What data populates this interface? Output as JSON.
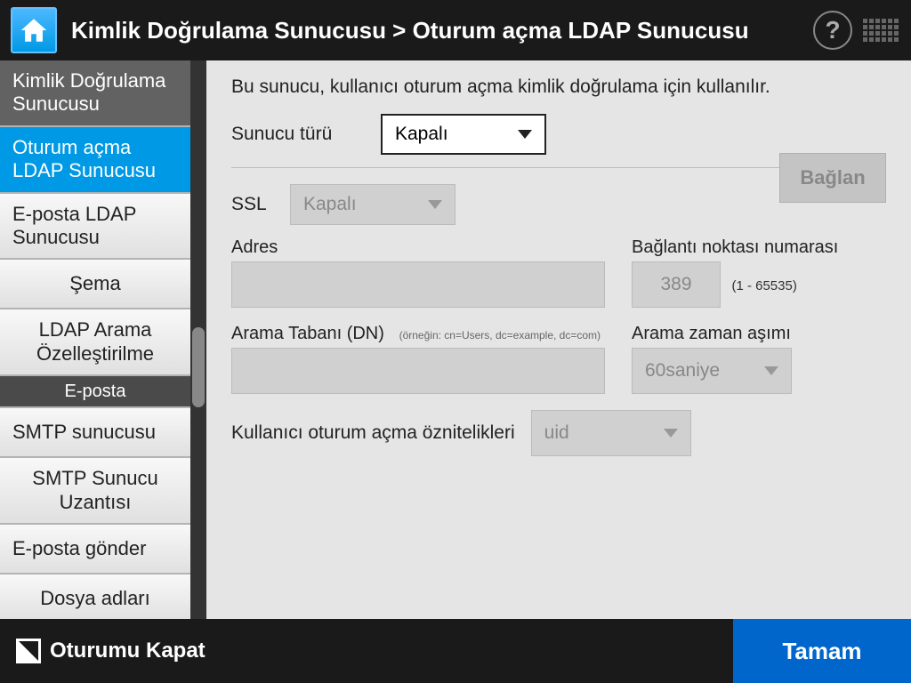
{
  "header": {
    "breadcrumb": "Kimlik Doğrulama Sunucusu  >  Oturum açma LDAP Sunucusu"
  },
  "sidebar": {
    "items": [
      {
        "label": "Kimlik Doğrulama Sunucusu",
        "type": "dark"
      },
      {
        "label": "Oturum açma LDAP Sunucusu",
        "type": "active"
      },
      {
        "label": "E-posta LDAP Sunucusu",
        "type": "normal"
      },
      {
        "label": "Şema",
        "type": "center"
      },
      {
        "label": "LDAP Arama Özelleştirilme",
        "type": "center"
      },
      {
        "label": "E-posta",
        "type": "section"
      },
      {
        "label": "SMTP sunucusu",
        "type": "normal"
      },
      {
        "label": "SMTP Sunucu Uzantısı",
        "type": "center"
      },
      {
        "label": "E-posta gönder",
        "type": "normal"
      },
      {
        "label": "Dosya adları",
        "type": "center"
      }
    ]
  },
  "main": {
    "description": "Bu sunucu, kullanıcı oturum açma kimlik doğrulama için kullanılır.",
    "server_type_label": "Sunucu türü",
    "server_type_value": "Kapalı",
    "connect_label": "Bağlan",
    "ssl_label": "SSL",
    "ssl_value": "Kapalı",
    "address_label": "Adres",
    "port_label": "Bağlantı noktası numarası",
    "port_value": "389",
    "port_range": "(1 - 65535)",
    "search_base_label": "Arama Tabanı (DN)",
    "search_base_hint": "(örneğin: cn=Users, dc=example, dc=com)",
    "timeout_label": "Arama zaman aşımı",
    "timeout_value": "60saniye",
    "login_attr_label": "Kullanıcı oturum açma öznitelikleri",
    "login_attr_value": "uid"
  },
  "footer": {
    "logout_label": "Oturumu Kapat",
    "ok_label": "Tamam"
  }
}
